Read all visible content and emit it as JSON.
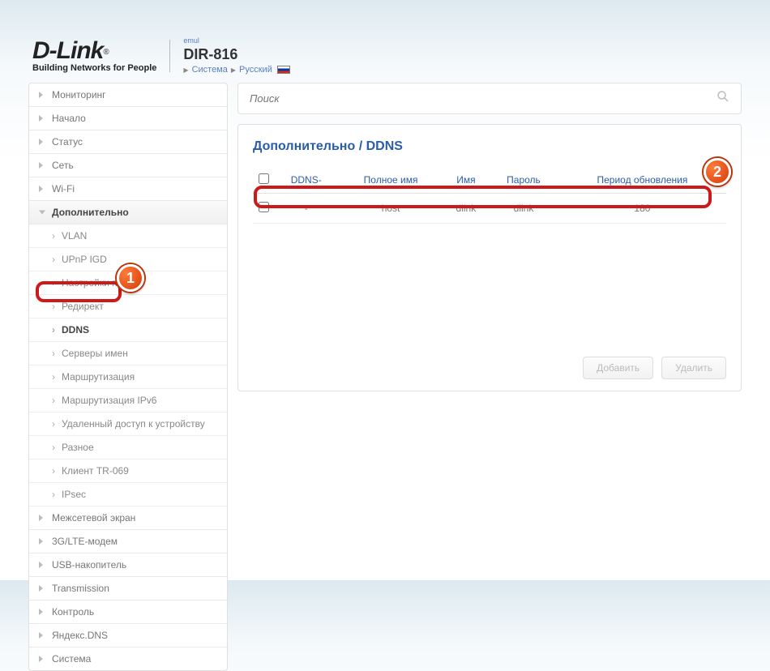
{
  "header": {
    "logo": "D-Link",
    "logo_r": "®",
    "tagline": "Building Networks for People",
    "emul": "emul",
    "model": "DIR-816",
    "bc_system": "Система",
    "bc_lang": "Русский"
  },
  "search": {
    "placeholder": "Поиск"
  },
  "sidebar": {
    "items": [
      {
        "label": "Мониторинг",
        "type": "top"
      },
      {
        "label": "Начало",
        "type": "top"
      },
      {
        "label": "Статус",
        "type": "top"
      },
      {
        "label": "Сеть",
        "type": "top"
      },
      {
        "label": "Wi-Fi",
        "type": "top"
      },
      {
        "label": "Дополнительно",
        "type": "top",
        "expanded": true
      },
      {
        "label": "VLAN",
        "type": "sub"
      },
      {
        "label": "UPnP IGD",
        "type": "sub"
      },
      {
        "label": "Настройки по",
        "type": "sub"
      },
      {
        "label": "Редирект",
        "type": "sub"
      },
      {
        "label": "DDNS",
        "type": "sub",
        "active": true
      },
      {
        "label": "Серверы имен",
        "type": "sub"
      },
      {
        "label": "Маршрутизация",
        "type": "sub"
      },
      {
        "label": "Маршрутизация IPv6",
        "type": "sub"
      },
      {
        "label": "Удаленный доступ к устройству",
        "type": "sub"
      },
      {
        "label": "Разное",
        "type": "sub"
      },
      {
        "label": "Клиент TR-069",
        "type": "sub"
      },
      {
        "label": "IPsec",
        "type": "sub"
      },
      {
        "label": "Межсетевой экран",
        "type": "top"
      },
      {
        "label": "3G/LTE-модем",
        "type": "top"
      },
      {
        "label": "USB-накопитель",
        "type": "top"
      },
      {
        "label": "Transmission",
        "type": "top"
      },
      {
        "label": "Контроль",
        "type": "top"
      },
      {
        "label": "Яндекс.DNS",
        "type": "top"
      },
      {
        "label": "Система",
        "type": "top"
      }
    ]
  },
  "page": {
    "title": "Дополнительно /  DDNS",
    "columns": [
      "DDNS-",
      "Полное имя",
      "Имя",
      "Пароль",
      "Период обновления"
    ],
    "rows": [
      {
        "ddns": "-",
        "fullname": "host",
        "name": "dlink",
        "password": "dlink",
        "period": "180"
      }
    ],
    "add": "Добавить",
    "del": "Удалить"
  },
  "markers": {
    "m1": "1",
    "m2": "2"
  }
}
